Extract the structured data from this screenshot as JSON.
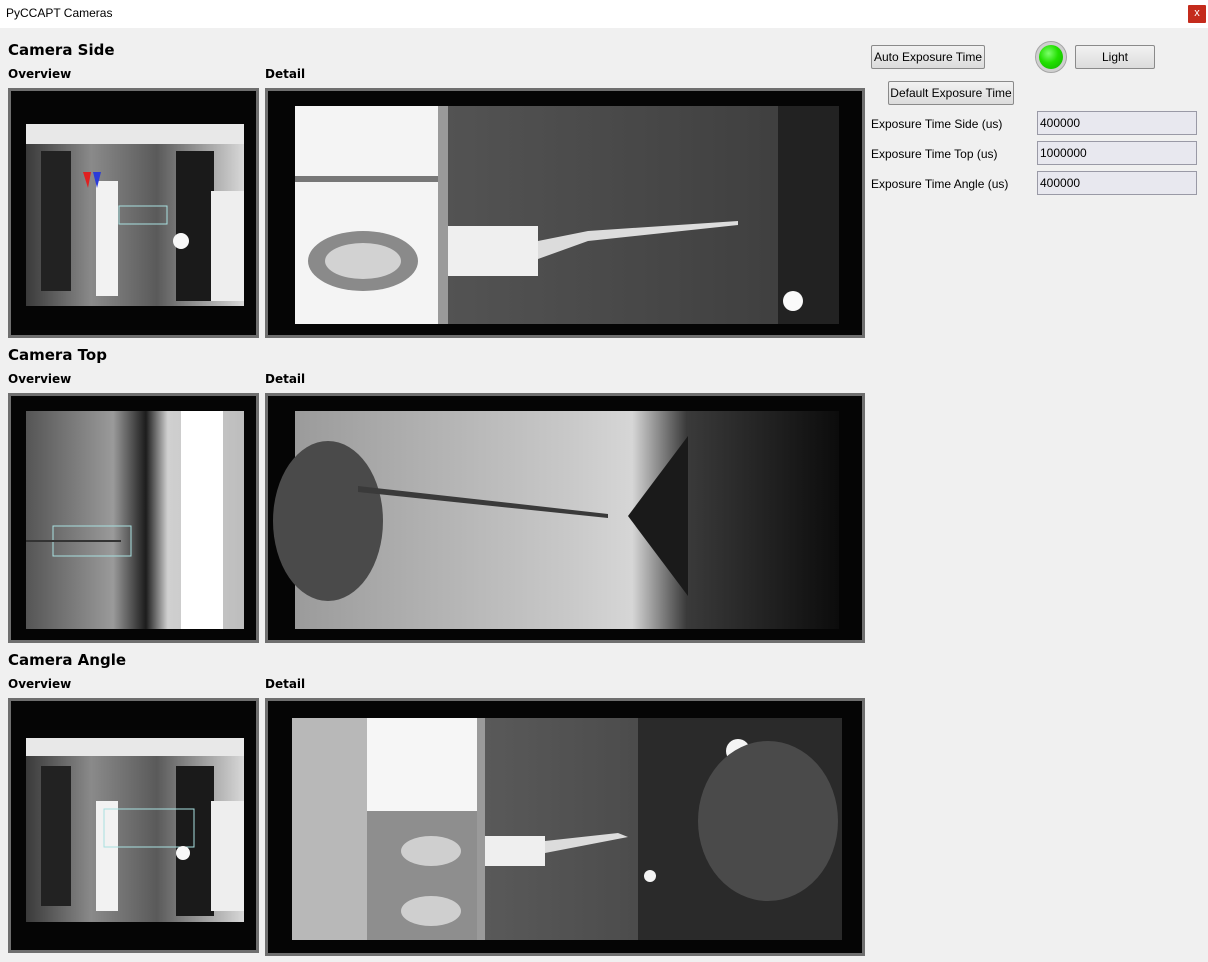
{
  "window": {
    "title": "PyCCAPT Cameras",
    "close_label": "x"
  },
  "columns": {
    "overview": "Overview",
    "detail": "Detail"
  },
  "cameras": [
    {
      "title": "Camera Side"
    },
    {
      "title": "Camera Top"
    },
    {
      "title": "Camera Angle"
    }
  ],
  "controls": {
    "auto_exposure_label": "Auto Exposure Time",
    "default_exposure_label": "Default Exposure Time",
    "light_label": "Light",
    "light_status_color": "#22e000",
    "exposure_fields": [
      {
        "label": "Exposure Time Side (us)",
        "value": "400000"
      },
      {
        "label": "Exposure Time Top (us)",
        "value": "1000000"
      },
      {
        "label": "Exposure Time Angle (us)",
        "value": "400000"
      }
    ]
  }
}
